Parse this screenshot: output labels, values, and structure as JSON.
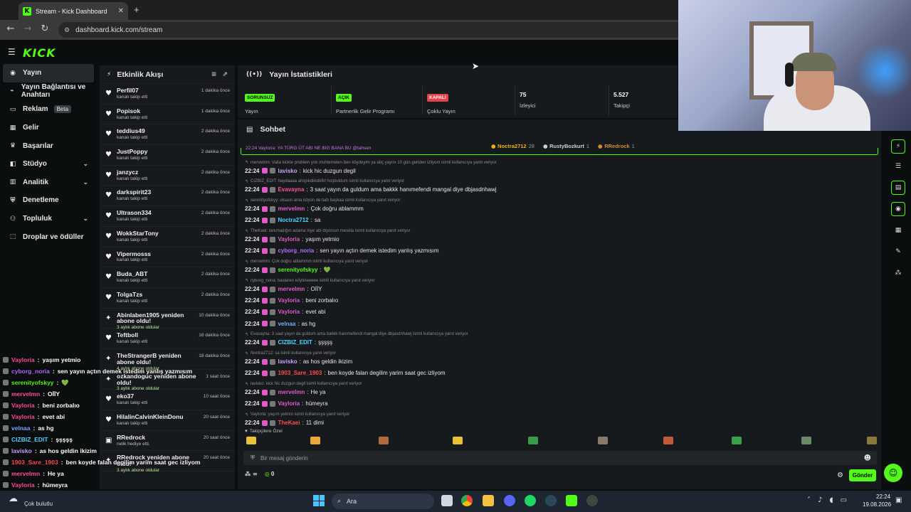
{
  "browser": {
    "tab_title": "Stream - Kick Dashboard",
    "url": "dashboard.kick.com/stream"
  },
  "kick": {
    "logo": "KICK"
  },
  "sidebar": {
    "items": [
      {
        "label": "Yayın",
        "icon": "broadcast-icon",
        "active": true
      },
      {
        "label": "Yayın Bağlantısı ve Anahtarı",
        "icon": "link-icon"
      },
      {
        "label": "Reklam",
        "icon": "ad-icon",
        "badge": "Beta"
      },
      {
        "label": "Gelir",
        "icon": "money-icon"
      },
      {
        "label": "Başarılar",
        "icon": "trophy-icon"
      },
      {
        "label": "Stüdyo",
        "icon": "studio-icon",
        "chevron": true
      },
      {
        "label": "Analitik",
        "icon": "chart-icon",
        "chevron": true
      },
      {
        "label": "Denetleme",
        "icon": "shield-icon"
      },
      {
        "label": "Topluluk",
        "icon": "users-icon",
        "chevron": true
      },
      {
        "label": "Droplar ve ödüller",
        "icon": "gift-icon"
      }
    ]
  },
  "feed": {
    "title": "Etkinlik Akışı",
    "items": [
      {
        "name": "Perfil07",
        "sub": "kanalı takip etti",
        "time": "1 dakika önce",
        "icon": "heart-icon"
      },
      {
        "name": "Popisok",
        "sub": "kanalı takip etti",
        "time": "1 dakika önce",
        "icon": "heart-icon"
      },
      {
        "name": "teddius49",
        "sub": "kanalı takip etti",
        "time": "2 dakika önce",
        "icon": "heart-icon"
      },
      {
        "name": "JustPoppy",
        "sub": "kanalı takip etti",
        "time": "2 dakika önce",
        "icon": "heart-icon"
      },
      {
        "name": "janzycz",
        "sub": "kanalı takip etti",
        "time": "2 dakika önce",
        "icon": "heart-icon"
      },
      {
        "name": "darkspirit23",
        "sub": "kanalı takip etti",
        "time": "2 dakika önce",
        "icon": "heart-icon"
      },
      {
        "name": "Ultrason334",
        "sub": "kanalı takip etti",
        "time": "2 dakika önce",
        "icon": "heart-icon"
      },
      {
        "name": "WokkStarTony",
        "sub": "kanalı takip etti",
        "time": "2 dakika önce",
        "icon": "heart-icon"
      },
      {
        "name": "Vipermosss",
        "sub": "kanalı takip etti",
        "time": "2 dakika önce",
        "icon": "heart-icon"
      },
      {
        "name": "Buda_ABT",
        "sub": "kanalı takip etti",
        "time": "2 dakika önce",
        "icon": "heart-icon"
      },
      {
        "name": "TolgaTzs",
        "sub": "kanalı takip etti",
        "time": "2 dakika önce",
        "icon": "heart-icon"
      },
      {
        "name": "Abinlaben1905 yeniden abone oldu!",
        "sub": "3 aylık abone oldular",
        "time": "10 dakika önce",
        "icon": "sparkle-icon",
        "green": true
      },
      {
        "name": "Teftboll",
        "sub": "kanalı takip etti",
        "time": "16 dakika önce",
        "icon": "heart-icon"
      },
      {
        "name": "TheStrangerB yeniden abone oldu!",
        "sub": "4 aylık abone oldular",
        "time": "18 dakika önce",
        "icon": "sparkle-icon",
        "green": true
      },
      {
        "name": "ozkandoguc yeniden abone oldu!",
        "sub": "3 aylık abone oldular",
        "time": "1 saat önce",
        "icon": "sparkle-icon",
        "green": true
      },
      {
        "name": "eko37",
        "sub": "kanalı takip etti",
        "time": "10 saat önce",
        "icon": "heart-icon"
      },
      {
        "name": "HilalinCalvinKleinDonu",
        "sub": "kanalı takip etti",
        "time": "20 saat önce",
        "icon": "heart-icon"
      },
      {
        "name": "RRedrock",
        "sub": "nelik hediye etti.",
        "time": "20 saat önce",
        "icon": "gift-icon"
      },
      {
        "name": "RRedrock yeniden abone oldu!",
        "sub": "3 aylık abone oldular",
        "time": "20 saat önce",
        "icon": "sparkle-icon",
        "green": true
      }
    ]
  },
  "stats": {
    "title": "Yayın İstatistikleri",
    "boxes": [
      {
        "pill": "SORUNSUZ",
        "pill_color": "#53fc18",
        "label": "Yayın"
      },
      {
        "pill": "AÇIK",
        "pill_color": "#53fc18",
        "label": "Partnerlik Gelir Programı"
      },
      {
        "pill": "KAPALI",
        "pill_color": "#e8404a",
        "label": "Çoklu Yayın"
      },
      {
        "value": "75",
        "label": "İzleyici"
      },
      {
        "value": "5.527",
        "label": "Takipçi"
      }
    ]
  },
  "chat": {
    "title": "Sohbet",
    "top": [
      {
        "name": "Noctra2712",
        "count": "28",
        "color": "#e8b21a"
      },
      {
        "name": "RustyBozkurt",
        "count": "1",
        "color": "#cfcfcf"
      },
      {
        "name": "RRedrock",
        "count": "1",
        "color": "#d38b3a"
      }
    ],
    "pinned": "22:24  Vayloria: YA TÜRG ÜT ABI NE BIG BANA BU @tahsen",
    "messages": [
      {
        "reply": "merveImn: Valla kickte problem yok muhtemelen ben köydeyim ya abç yayını 10 gün geriden izliyom isimli kullanıcıya yanıt veriyor"
      },
      {
        "time": "22:24",
        "user": "lavisko",
        "color": "#c9a0ff",
        "text": "kick hic duzgun degil"
      },
      {
        "reply": "CIZBIZ_EDIT: haydaaaa ahsjskdkkdkfkf hoşbuldum isimli kullanıcıya yanıt veriyor"
      },
      {
        "time": "22:24",
        "user": "Evavayna",
        "color": "#ff4fa3",
        "text": "3 saat yayın da guldum ama bakkk hanımefendi mangal diye dbjasdnhawj"
      },
      {
        "reply": "serenityofskyy: olsaun ama köyün de tadı başkaa isimli kullanıcıya yanıt veriyor"
      },
      {
        "time": "22:24",
        "user": "merveImn",
        "color": "#e05ac8",
        "text": "Çok doğru ablammm"
      },
      {
        "time": "22:24",
        "user": "Noctra2712",
        "color": "#4ad4ff",
        "text": "sa"
      },
      {
        "reply": "TheKaei: tanımadığın adama niye abi diyorsun mesela isimli kullanıcıya yanıt veriyor"
      },
      {
        "time": "22:24",
        "user": "Vayloria",
        "color": "#e05ac8",
        "text": "yaşım yetmio"
      },
      {
        "time": "22:24",
        "user": "cyborg_noria",
        "color": "#b26bff",
        "text": "sen yayın açtın demek istedim yanlış yazmısım"
      },
      {
        "reply": "merveImn: Çok doğru ablammm isimli kullanıcıya yanıt veriyor"
      },
      {
        "time": "22:24",
        "user": "serenityofskyy",
        "color": "#53fc18",
        "text": "💚"
      },
      {
        "reply": "cyborg_noria: baslaren köytineeeee isimli kullanıcıya yanıt veriyor"
      },
      {
        "time": "22:24",
        "user": "merveImn",
        "color": "#e05ac8",
        "text": "OİİY"
      },
      {
        "time": "22:24",
        "user": "Vayloria",
        "color": "#e05ac8",
        "text": "beni zorbalıo"
      },
      {
        "time": "22:24",
        "user": "Vayloria",
        "color": "#e05ac8",
        "text": "evet abi"
      },
      {
        "time": "22:24",
        "user": "velnaa",
        "color": "#7aa8ff",
        "text": "as hg"
      },
      {
        "reply": "Evavayna: 3 saat yayın da guldum ama bakkk hanımefendi mangal diye dbjasdnhawj isimli kullanıcıya yanıt veriyor"
      },
      {
        "time": "22:24",
        "user": "CIZBIZ_EDIT",
        "color": "#4ad4ff",
        "text": "şşşşş"
      },
      {
        "reply": "Noctra2712: sa isimli kullanıcıya yanıt veriyor"
      },
      {
        "time": "22:24",
        "user": "lavisko",
        "color": "#c9a0ff",
        "text": "as hos geldin ikizim"
      },
      {
        "time": "22:24",
        "user": "1903_Sare_1903",
        "color": "#ff4a4a",
        "text": "ben koyde falan degilim yarim saat gec izliyom"
      },
      {
        "reply": "lavisko: kick hic duzgun degil isimli kullanıcıya yanıt veriyor"
      },
      {
        "time": "22:24",
        "user": "merveImn",
        "color": "#e05ac8",
        "text": "He ya"
      },
      {
        "time": "22:24",
        "user": "Vayloria",
        "color": "#e05ac8",
        "text": "hümeyra"
      },
      {
        "reply": "Vayloria: yaşım yetmio isimli kullanıcıya yanıt veriyor"
      },
      {
        "time": "22:24",
        "user": "TheKaei",
        "color": "#ff4a4a",
        "text": "11 dimi"
      }
    ],
    "follower_special": "Takipçilere Özel",
    "input_placeholder": "Bir mesaj gönderin",
    "points": "0",
    "send_label": "Gönder"
  },
  "overlay": [
    {
      "user": "Vayloria",
      "color": "#ff4fa3",
      "text": "yaşım yetmio"
    },
    {
      "user": "cyborg_noria",
      "color": "#b26bff",
      "text": "sen yayın açtın demek istedim yanlış yazmısım"
    },
    {
      "user": "serenityofskyy",
      "color": "#53fc18",
      "text": "💚"
    },
    {
      "user": "merveImn",
      "color": "#ff4fa3",
      "text": "OİİY"
    },
    {
      "user": "Vayloria",
      "color": "#ff4fa3",
      "text": "beni zorbalıo"
    },
    {
      "user": "Vayloria",
      "color": "#ff4fa3",
      "text": "evet abi"
    },
    {
      "user": "velnaa",
      "color": "#7aa8ff",
      "text": "as hg"
    },
    {
      "user": "CIZBIZ_EDIT",
      "color": "#4ad4ff",
      "text": "şşşşş"
    },
    {
      "user": "lavisko",
      "color": "#c9a0ff",
      "text": "as hos geldin ikizim"
    },
    {
      "user": "1903_Sare_1903",
      "color": "#ff4a4a",
      "text": "ben koyde falan degilim yarim saat gec izliyom"
    },
    {
      "user": "merveImn",
      "color": "#ff4fa3",
      "text": "He ya"
    },
    {
      "user": "Vayloria",
      "color": "#ff4fa3",
      "text": "hümeyra"
    },
    {
      "user": "TheKaei",
      "color": "#ff4a4a",
      "text": "11 dimi"
    }
  ],
  "taskbar": {
    "weather": "Çok bulutlu",
    "search": "Ara",
    "time": "22:24",
    "date": "19.08.2026"
  }
}
